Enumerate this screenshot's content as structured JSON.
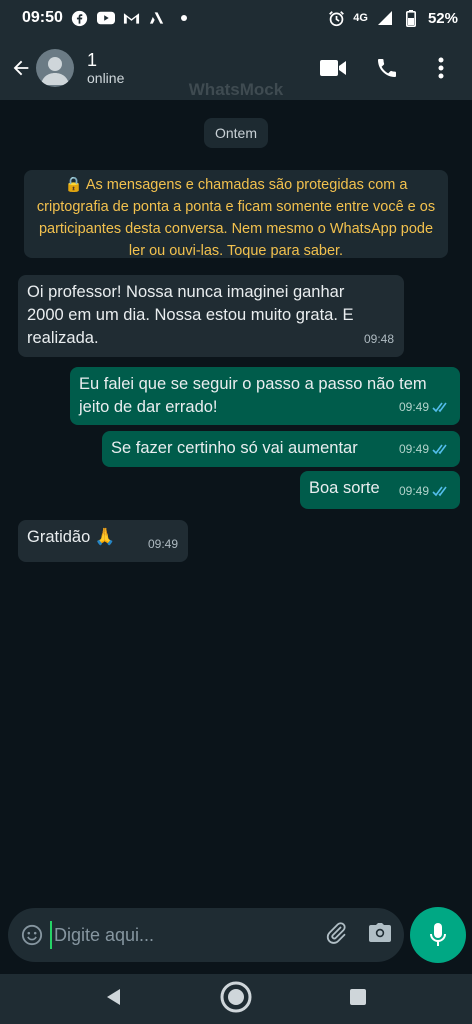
{
  "status_bar": {
    "time": "09:50",
    "network": "4G",
    "battery": "52%",
    "notification_icons": [
      "facebook-icon",
      "youtube-icon",
      "gmail-icon",
      "app-icon",
      "dot-icon"
    ]
  },
  "header": {
    "contact_name": "1",
    "contact_status": "online",
    "watermark": "WhatsMock"
  },
  "chat": {
    "date_chip": "Ontem",
    "encryption_notice": "🔒 As mensagens e chamadas são protegidas com a criptografia de ponta a ponta e ficam somente entre você e os participantes desta conversa. Nem mesmo o WhatsApp pode ler ou  ouvi-las. Toque para saber.",
    "messages": [
      {
        "direction": "in",
        "text": "Oi professor! Nossa nunca imaginei ganhar 2000 em um dia. Nossa estou muito grata. E realizada.",
        "time": "09:48"
      },
      {
        "direction": "out",
        "text": "Eu falei que se seguir o passo a passo não tem jeito de dar errado!",
        "time": "09:49",
        "status": "read"
      },
      {
        "direction": "out",
        "text": "Se fazer certinho só vai aumentar",
        "time": "09:49",
        "status": "read"
      },
      {
        "direction": "out",
        "text": "Boa sorte",
        "time": "09:49",
        "status": "read"
      },
      {
        "direction": "in",
        "text": "Gratidão 🙏",
        "time": "09:49"
      }
    ]
  },
  "composer": {
    "placeholder": "Digite aqui..."
  },
  "colors": {
    "background": "#0b141a",
    "bar": "#1f2c33",
    "incoming_bubble": "#202c33",
    "outgoing_bubble": "#005c4b",
    "accent": "#00a884",
    "read_ticks": "#53bdeb",
    "notice_text": "#f2c14e"
  }
}
